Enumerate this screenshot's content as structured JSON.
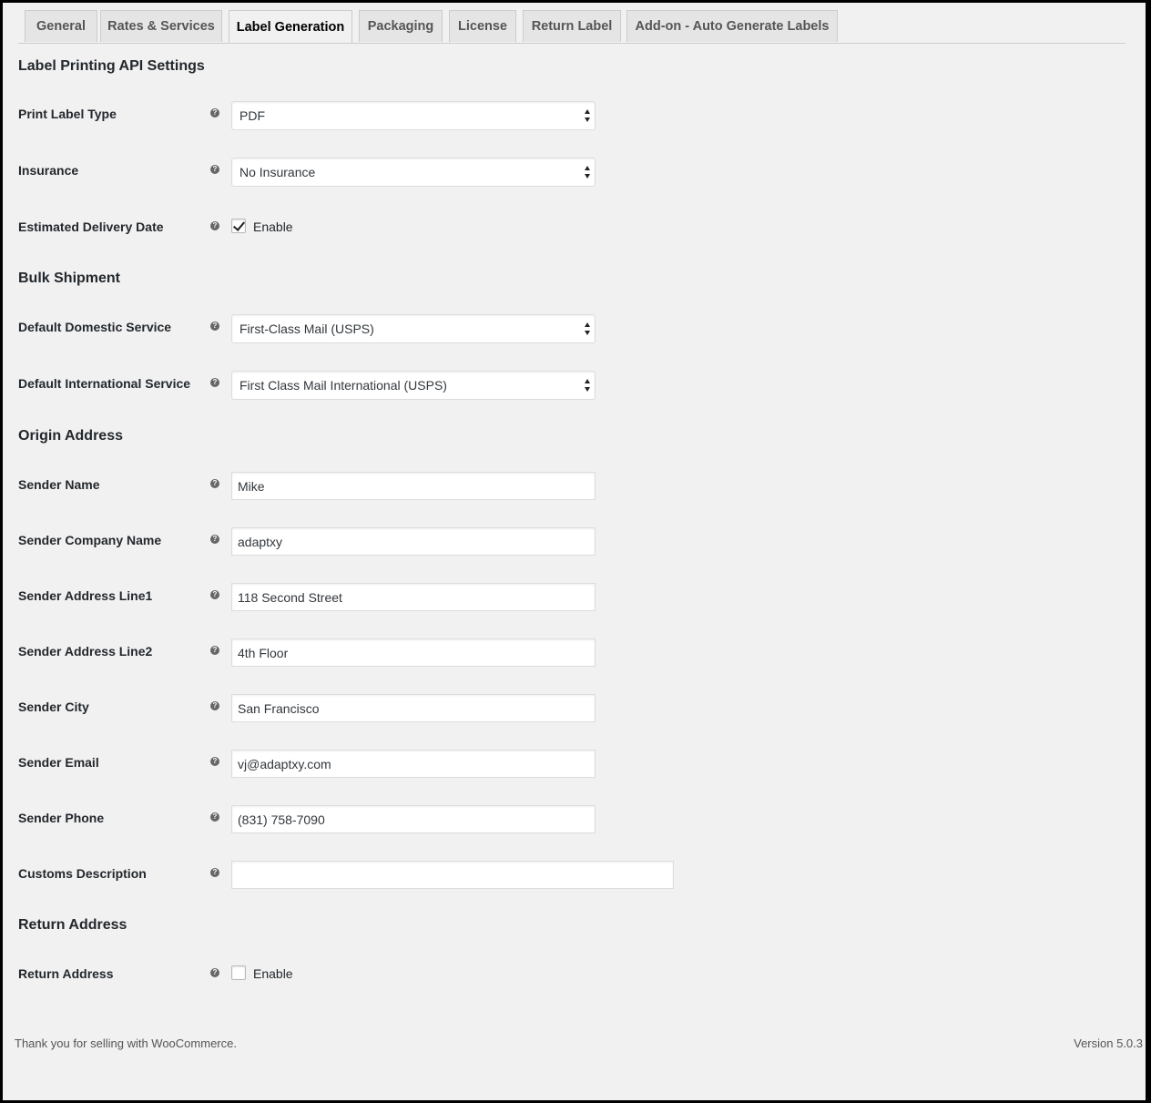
{
  "tabs": [
    {
      "label": "General"
    },
    {
      "label": "Rates & Services"
    },
    {
      "label": "Label Generation"
    },
    {
      "label": "Packaging"
    },
    {
      "label": "License"
    },
    {
      "label": "Return Label"
    },
    {
      "label": "Add-on - Auto Generate Labels"
    }
  ],
  "sections": {
    "label_printing": "Label Printing API Settings",
    "bulk": "Bulk Shipment",
    "origin": "Origin Address",
    "return": "Return Address"
  },
  "fields": {
    "print_label_type": {
      "label": "Print Label Type",
      "value": "PDF"
    },
    "insurance": {
      "label": "Insurance",
      "value": "No Insurance"
    },
    "estimated_delivery": {
      "label": "Estimated Delivery Date",
      "checkbox_label": "Enable",
      "checked": true
    },
    "default_domestic": {
      "label": "Default Domestic Service",
      "value": "First-Class Mail (USPS)"
    },
    "default_international": {
      "label": "Default International Service",
      "value": "First Class Mail International (USPS)"
    },
    "sender_name": {
      "label": "Sender Name",
      "value": "Mike"
    },
    "sender_company": {
      "label": "Sender Company Name",
      "value": "adaptxy"
    },
    "sender_address1": {
      "label": "Sender Address Line1",
      "value": "118 Second Street"
    },
    "sender_address2": {
      "label": "Sender Address Line2",
      "value": "4th Floor"
    },
    "sender_city": {
      "label": "Sender City",
      "value": "San Francisco"
    },
    "sender_email": {
      "label": "Sender Email",
      "value": "vj@adaptxy.com"
    },
    "sender_phone": {
      "label": "Sender Phone",
      "value": "(831) 758-7090"
    },
    "customs_description": {
      "label": "Customs Description",
      "value": ""
    },
    "return_address": {
      "label": "Return Address",
      "checkbox_label": "Enable",
      "checked": false
    }
  },
  "help_glyph": "?",
  "footer": {
    "thanks": "Thank you for selling with WooCommerce.",
    "version": "Version 5.0.3"
  }
}
